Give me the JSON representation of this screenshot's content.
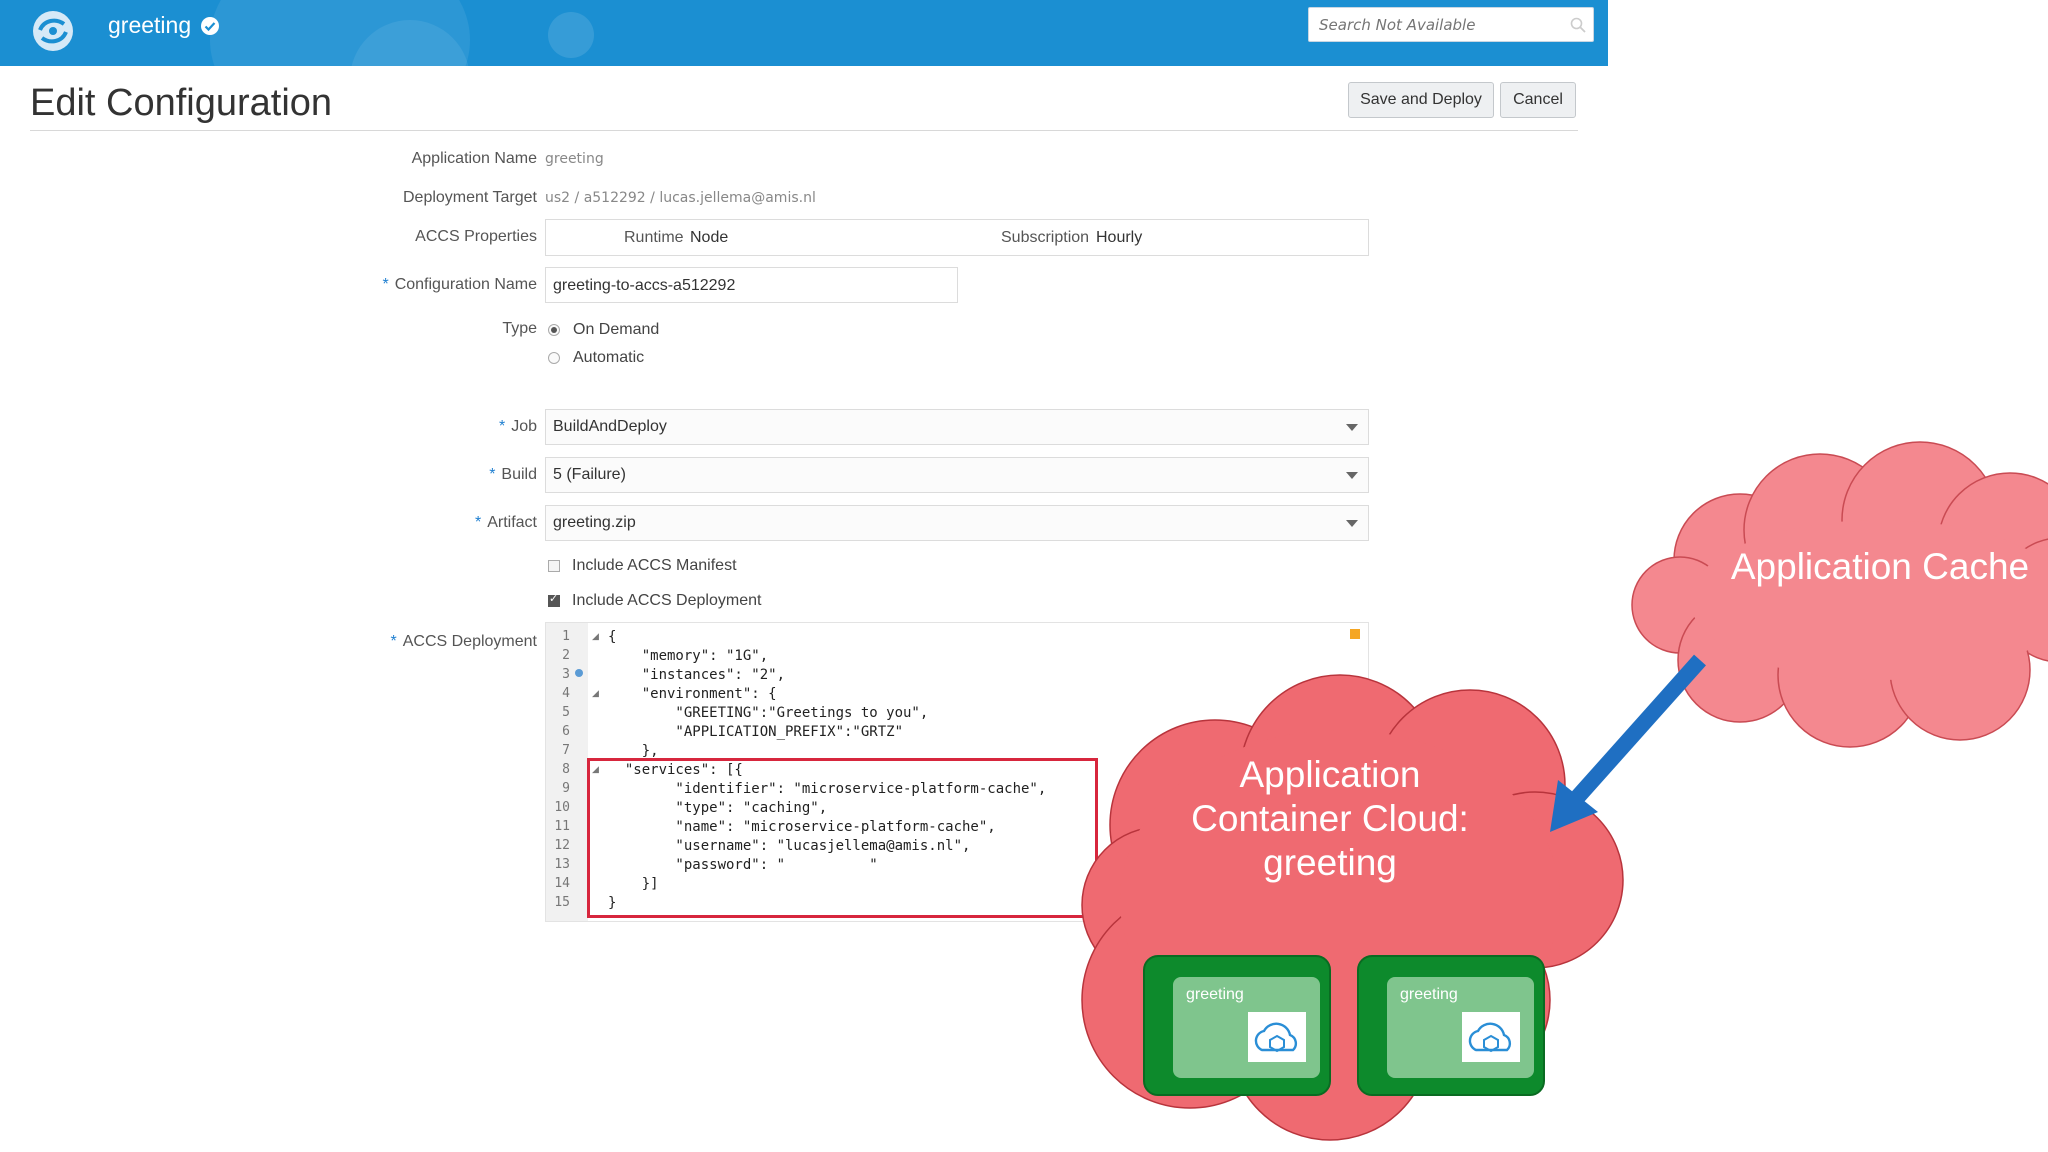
{
  "header": {
    "app_name": "greeting",
    "search_placeholder": "Search Not Available"
  },
  "page": {
    "title": "Edit Configuration",
    "save_deploy_label": "Save and Deploy",
    "cancel_label": "Cancel"
  },
  "form": {
    "application_name": {
      "label": "Application Name",
      "value": "greeting"
    },
    "deployment_target": {
      "label": "Deployment Target",
      "value": "us2 / a512292 / lucas.jellema@amis.nl"
    },
    "accs_properties": {
      "label": "ACCS Properties",
      "runtime_label": "Runtime",
      "runtime_value": "Node",
      "subscription_label": "Subscription",
      "subscription_value": "Hourly"
    },
    "configuration_name": {
      "label": "Configuration Name",
      "value": "greeting-to-accs-a512292"
    },
    "type": {
      "label": "Type",
      "options": [
        "On Demand",
        "Automatic"
      ],
      "selected": "On Demand"
    },
    "job": {
      "label": "Job",
      "value": "BuildAndDeploy"
    },
    "build": {
      "label": "Build",
      "value": "5 (Failure)"
    },
    "artifact": {
      "label": "Artifact",
      "value": "greeting.zip"
    },
    "include_manifest": {
      "label": "Include ACCS Manifest",
      "checked": false
    },
    "include_deployment": {
      "label": "Include ACCS Deployment",
      "checked": true
    },
    "accs_deployment": {
      "label": "ACCS Deployment"
    }
  },
  "code": {
    "lines": [
      {
        "n": "1",
        "text": "{"
      },
      {
        "n": "2",
        "text": "    \"memory\": \"1G\","
      },
      {
        "n": "3",
        "text": "    \"instances\": \"2\","
      },
      {
        "n": "4",
        "text": "    \"environment\": {"
      },
      {
        "n": "5",
        "text": "        \"GREETING\":\"Greetings to you\","
      },
      {
        "n": "6",
        "text": "        \"APPLICATION_PREFIX\":\"GRTZ\""
      },
      {
        "n": "7",
        "text": "    },"
      },
      {
        "n": "8",
        "text": "  \"services\": [{"
      },
      {
        "n": "9",
        "text": "        \"identifier\": \"microservice-platform-cache\","
      },
      {
        "n": "10",
        "text": "        \"type\": \"caching\","
      },
      {
        "n": "11",
        "text": "        \"name\": \"microservice-platform-cache\","
      },
      {
        "n": "12",
        "text": "        \"username\": \"lucasjellema@amis.nl\","
      },
      {
        "n": "13",
        "text": "        \"password\": \"          \""
      },
      {
        "n": "14",
        "text": "    }]"
      },
      {
        "n": "15",
        "text": "}"
      }
    ]
  },
  "diagram": {
    "app_cache_label": "Application Cache",
    "acc_label_line1": "Application",
    "acc_label_line2": "Container Cloud:",
    "acc_label_line3": "greeting",
    "instances": [
      "greeting",
      "greeting"
    ]
  },
  "colors": {
    "header_blue": "#1b8fd2",
    "cloud_pink": "#f4888f",
    "cloud_red": "#ef6a71",
    "instance_green": "#1a9a3c",
    "arrow_blue": "#1f6fc2",
    "highlight_red": "#d7263d"
  }
}
